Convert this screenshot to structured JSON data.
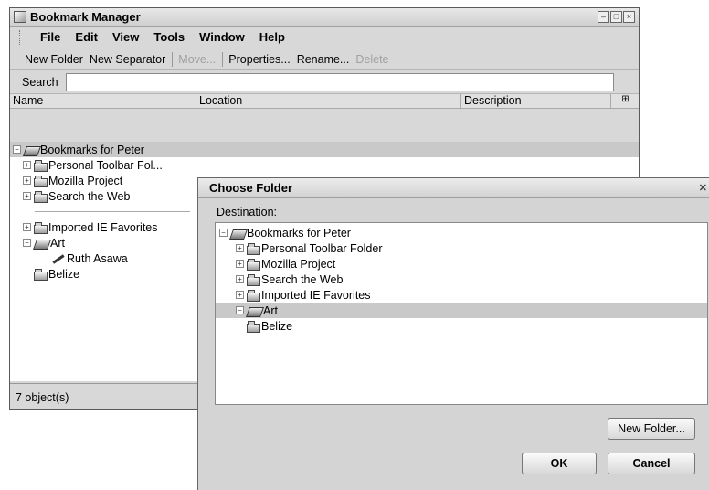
{
  "main_window": {
    "title": "Bookmark Manager",
    "menu": [
      "File",
      "Edit",
      "View",
      "Tools",
      "Window",
      "Help"
    ],
    "toolbar": {
      "new_folder": "New Folder",
      "new_separator": "New Separator",
      "move": "Move...",
      "properties": "Properties...",
      "rename": "Rename...",
      "delete": "Delete"
    },
    "search_label": "Search",
    "search_value": "",
    "columns": [
      "Name",
      "Location",
      "Description"
    ],
    "tree": {
      "root": "Bookmarks for Peter",
      "items": [
        "Personal Toolbar Fol...",
        "Mozilla Project",
        "Search the Web",
        "Imported IE Favorites",
        "Art",
        "Ruth Asawa",
        "Belize"
      ]
    },
    "status": "7 object(s)"
  },
  "dialog": {
    "title": "Choose Folder",
    "destination_label": "Destination:",
    "tree": {
      "root": "Bookmarks for Peter",
      "items": [
        "Personal Toolbar Folder",
        "Mozilla Project",
        "Search the Web",
        "Imported IE Favorites",
        "Art",
        "Belize"
      ]
    },
    "new_folder_button": "New Folder...",
    "ok_button": "OK",
    "cancel_button": "Cancel"
  },
  "colors": {
    "window_bg": "#d8d8d8",
    "selection": "#c9c9c9"
  }
}
